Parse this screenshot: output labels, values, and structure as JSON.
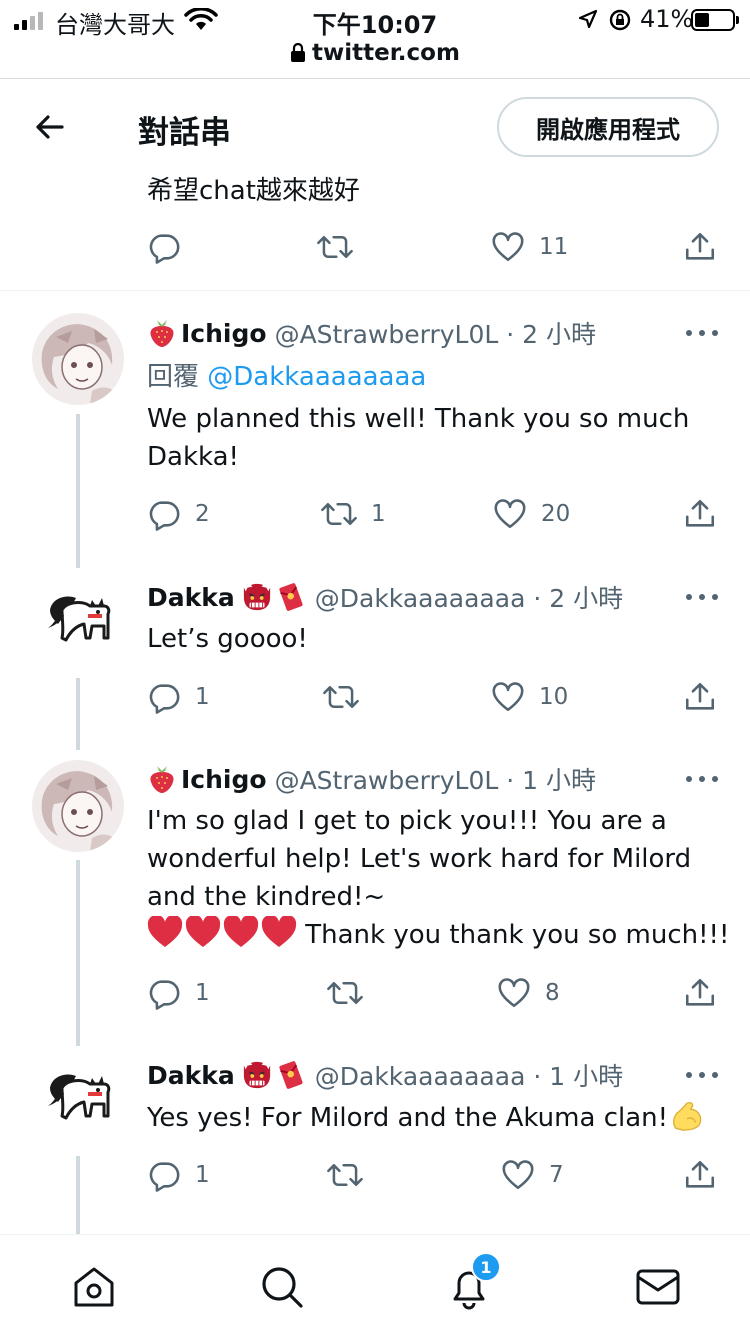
{
  "status_bar": {
    "carrier": "台灣大哥大",
    "time": "下午10:07",
    "battery": "41%",
    "url": "twitter.com"
  },
  "header": {
    "title": "對話串",
    "open_app": "開啟應用程式"
  },
  "first_tweet": {
    "text": "希望chat越來越好",
    "likes": "11"
  },
  "tweets": [
    {
      "name": "Ichigo",
      "handle": "@AStrawberryL0L · 2 小時",
      "reply_prefix": "回覆",
      "reply_mention": "@Dakkaaaaaaaa",
      "text": "We planned this well! Thank you so much Dakka!",
      "replies": "2",
      "retweets": "1",
      "likes": "20"
    },
    {
      "name": "Dakka",
      "handle": "@Dakkaaaaaaaa · 2 小時",
      "text": "Let’s goooo!",
      "replies": "1",
      "retweets": "",
      "likes": "10"
    },
    {
      "name": "Ichigo",
      "handle": "@AStrawberryL0L · 1 小時",
      "text": "I'm so glad I get to pick you!!! You are a wonderful help! Let's work hard for Milord and the kindred!~",
      "hearts_line": "Thank you thank you so much!!!",
      "replies": "1",
      "retweets": "",
      "likes": "8"
    },
    {
      "name": "Dakka",
      "handle": "@Dakkaaaaaaaa · 1 小時",
      "text": "Yes yes! For Milord and the Akuma clan!",
      "replies": "1",
      "retweets": "",
      "likes": "7"
    }
  ],
  "bottom_nav": {
    "notification_count": "1"
  },
  "icons": [
    "back-arrow-icon",
    "reply-icon",
    "retweet-icon",
    "like-icon",
    "share-icon",
    "more-icon",
    "home-icon",
    "search-icon",
    "bell-icon",
    "mail-icon"
  ],
  "colors": {
    "accent": "#1d9bf0",
    "muted": "#536471",
    "heart_emoji": "#dd2e44"
  }
}
